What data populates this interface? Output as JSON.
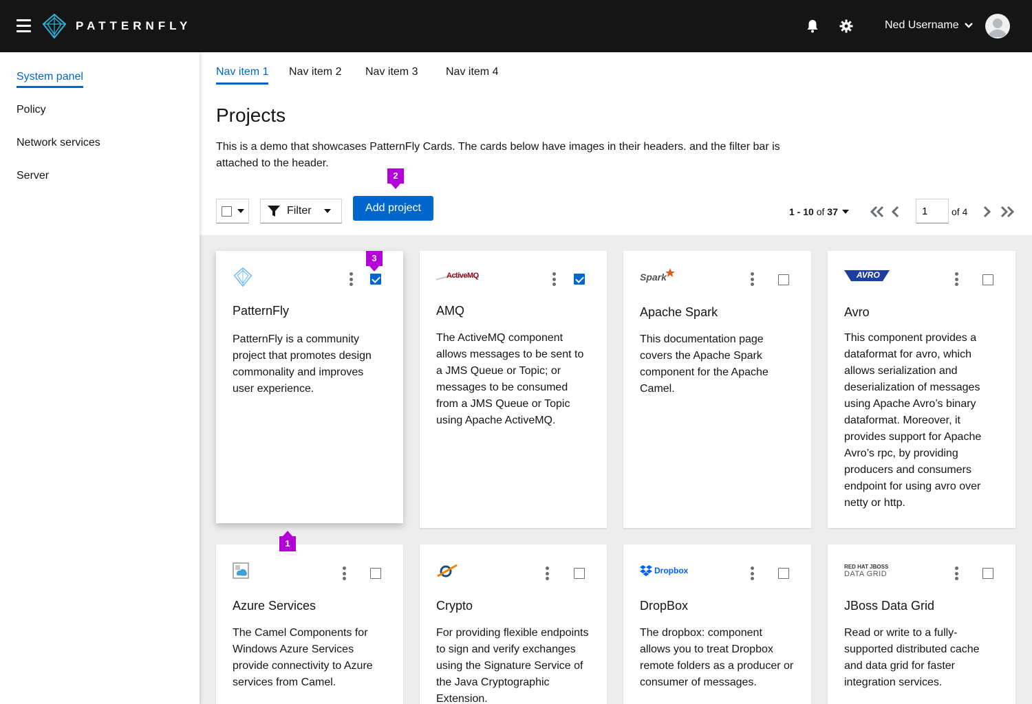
{
  "masthead": {
    "brand": "PATTERNFLY",
    "user_name": "Ned Username"
  },
  "sidebar": {
    "items": [
      {
        "label": "System panel"
      },
      {
        "label": "Policy"
      },
      {
        "label": "Network services"
      },
      {
        "label": "Server"
      }
    ]
  },
  "nav": {
    "tabs": [
      {
        "label": "Nav item 1"
      },
      {
        "label": "Nav item 2"
      },
      {
        "label": "Nav item 3"
      },
      {
        "label": "Nav item 4"
      }
    ]
  },
  "page": {
    "title": "Projects",
    "description": "This is a demo that showcases PatternFly Cards. The cards below have images in their headers. and the filter bar is attached to the header."
  },
  "toolbar": {
    "filter_label": "Filter",
    "add_label": "Add project",
    "pagination": {
      "range": "1 - 10",
      "of_text": "of",
      "total": "37",
      "page_value": "1",
      "pages_label": "of 4"
    }
  },
  "cards": [
    {
      "logo": "patternfly-logo",
      "title": "PatternFly",
      "selected": true,
      "body": "PatternFly is a community project that promotes design commonality and improves user experience."
    },
    {
      "logo": "activemq-logo",
      "logo_text": "ActiveMQ",
      "title": "AMQ",
      "selected": true,
      "body": "The ActiveMQ component allows messages to be sent to a JMS Queue or Topic; or messages to be consumed from a JMS Queue or Topic using Apache ActiveMQ."
    },
    {
      "logo": "spark-logo",
      "logo_text": "Spark",
      "title": "Apache Spark",
      "selected": false,
      "body": "This documentation page covers the Apache Spark component for the Apache Camel."
    },
    {
      "logo": "avro-logo",
      "logo_text": "AVRO",
      "title": "Avro",
      "selected": false,
      "body": "This component provides a dataformat for avro, which allows serialization and deserialization of messages using Apache Avro’s binary dataformat. Moreover, it provides support for Apache Avro’s rpc, by providing producers and consumers endpoint for using avro over netty or http."
    },
    {
      "logo": "azure-logo",
      "title": "Azure Services",
      "selected": false,
      "body": "The Camel Components for Windows Azure Services provide connectivity to Azure services from Camel."
    },
    {
      "logo": "crypto-logo",
      "title": "Crypto",
      "selected": false,
      "body": "For providing flexible endpoints to sign and verify exchanges using the Signature Service of the Java Cryptographic Extension."
    },
    {
      "logo": "dropbox-logo",
      "logo_text": "Dropbox",
      "title": "DropBox",
      "selected": false,
      "body": "The dropbox: component allows you to treat Dropbox remote folders as a producer or consumer of messages."
    },
    {
      "logo": "jboss-datagrid-logo",
      "logo_text_1": "RED HAT JBOSS",
      "logo_text_2": "DATA GRID",
      "title": "JBoss Data Grid",
      "selected": false,
      "body": "Read or write to a fully-supported distributed cache and data grid for faster integration services."
    }
  ],
  "callouts": [
    "1",
    "2",
    "3"
  ],
  "colors": {
    "masthead_bg": "#151515",
    "accent": "#0066cc",
    "callout": "#b400d8",
    "gallery_bg": "#ededed"
  }
}
